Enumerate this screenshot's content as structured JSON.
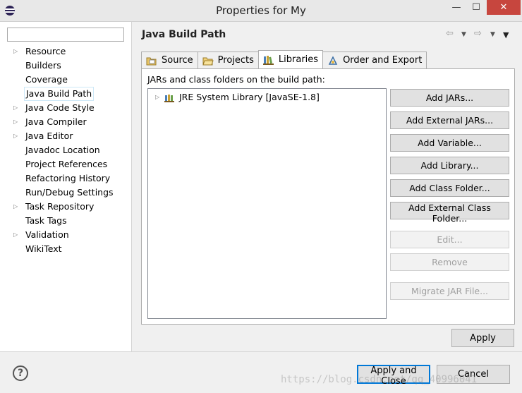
{
  "window": {
    "title": "Properties for My",
    "minimize_glyph": "—",
    "maximize_glyph": "☐",
    "close_glyph": "✕"
  },
  "filter": {
    "value": "",
    "placeholder": ""
  },
  "tree": [
    {
      "label": "Resource",
      "expandable": true
    },
    {
      "label": "Builders",
      "expandable": false
    },
    {
      "label": "Coverage",
      "expandable": false
    },
    {
      "label": "Java Build Path",
      "expandable": false,
      "selected": true
    },
    {
      "label": "Java Code Style",
      "expandable": true
    },
    {
      "label": "Java Compiler",
      "expandable": true
    },
    {
      "label": "Java Editor",
      "expandable": true
    },
    {
      "label": "Javadoc Location",
      "expandable": false
    },
    {
      "label": "Project References",
      "expandable": false
    },
    {
      "label": "Refactoring History",
      "expandable": false
    },
    {
      "label": "Run/Debug Settings",
      "expandable": false
    },
    {
      "label": "Task Repository",
      "expandable": true
    },
    {
      "label": "Task Tags",
      "expandable": false
    },
    {
      "label": "Validation",
      "expandable": true
    },
    {
      "label": "WikiText",
      "expandable": false
    }
  ],
  "header": {
    "title": "Java Build Path",
    "back_glyph": "⇦",
    "forward_glyph": "⇨",
    "dropdown_glyph": "▼"
  },
  "tabs": [
    {
      "label": "Source",
      "icon": "source-folder-icon"
    },
    {
      "label": "Projects",
      "icon": "projects-folder-icon"
    },
    {
      "label": "Libraries",
      "icon": "libraries-icon",
      "active": true
    },
    {
      "label": "Order and Export",
      "icon": "order-export-icon"
    }
  ],
  "libraries": {
    "caption": "JARs and class folders on the build path:",
    "entries": [
      {
        "label": "JRE System Library [JavaSE-1.8]",
        "icon": "jre-library-icon"
      }
    ],
    "buttons": [
      {
        "label": "Add JARs...",
        "enabled": true
      },
      {
        "label": "Add External JARs...",
        "enabled": true
      },
      {
        "label": "Add Variable...",
        "enabled": true
      },
      {
        "label": "Add Library...",
        "enabled": true
      },
      {
        "label": "Add Class Folder...",
        "enabled": true
      },
      {
        "label": "Add External Class Folder...",
        "enabled": true
      },
      {
        "label": "Edit...",
        "enabled": false
      },
      {
        "label": "Remove",
        "enabled": false
      },
      {
        "label": "Migrate JAR File...",
        "enabled": false
      }
    ]
  },
  "apply_label": "Apply",
  "footer": {
    "help_glyph": "?",
    "apply_close_label": "Apply and Close",
    "cancel_label": "Cancel",
    "watermark": "https://blog.csdn.net/qq_40996041"
  }
}
